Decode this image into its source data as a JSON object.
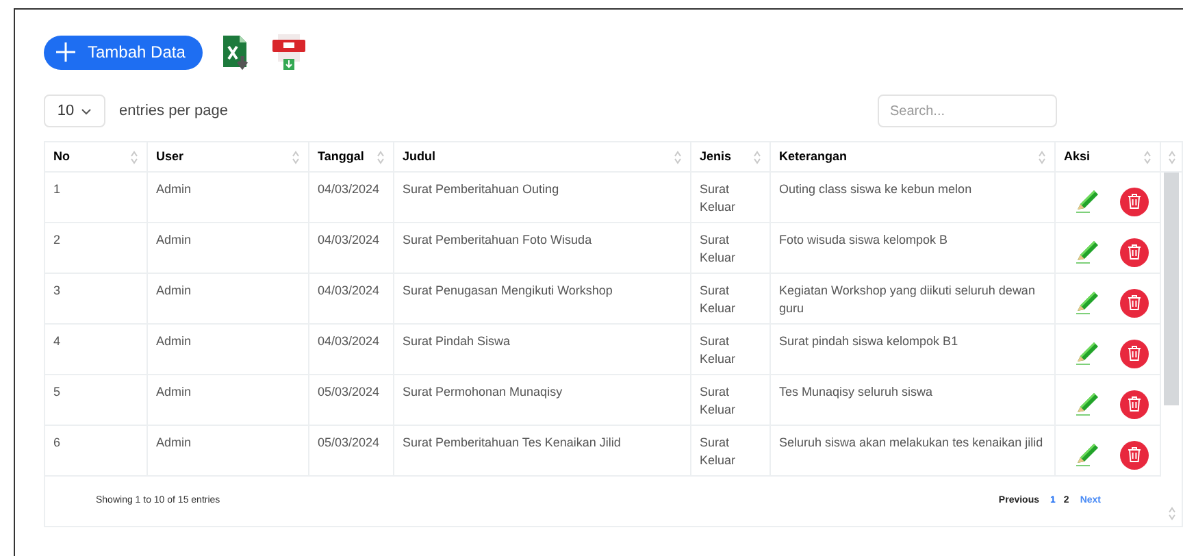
{
  "toolbar": {
    "add_button": "Tambah Data"
  },
  "page_size": {
    "value": "10",
    "label": "entries per page"
  },
  "search": {
    "placeholder": "Search..."
  },
  "table": {
    "columns": [
      "No",
      "User",
      "Tanggal",
      "Judul",
      "Jenis",
      "Keterangan",
      "Aksi"
    ],
    "rows": [
      {
        "no": "1",
        "user": "Admin",
        "tanggal": "04/03/2024",
        "judul": "Surat Pemberitahuan Outing",
        "jenis": "Surat Keluar",
        "keterangan": "Outing class siswa ke kebun melon"
      },
      {
        "no": "2",
        "user": "Admin",
        "tanggal": "04/03/2024",
        "judul": "Surat Pemberitahuan Foto Wisuda",
        "jenis": "Surat Keluar",
        "keterangan": "Foto wisuda siswa kelompok B"
      },
      {
        "no": "3",
        "user": "Admin",
        "tanggal": "04/03/2024",
        "judul": "Surat Penugasan Mengikuti Workshop",
        "jenis": "Surat Keluar",
        "keterangan": "Kegiatan Workshop yang diikuti seluruh dewan guru"
      },
      {
        "no": "4",
        "user": "Admin",
        "tanggal": "04/03/2024",
        "judul": "Surat Pindah Siswa",
        "jenis": "Surat Keluar",
        "keterangan": "Surat pindah siswa kelompok B1"
      },
      {
        "no": "5",
        "user": "Admin",
        "tanggal": "05/03/2024",
        "judul": "Surat Permohonan Munaqisy",
        "jenis": "Surat Keluar",
        "keterangan": "Tes Munaqisy seluruh siswa"
      },
      {
        "no": "6",
        "user": "Admin",
        "tanggal": "05/03/2024",
        "judul": "Surat Pemberitahuan Tes Kenaikan Jilid",
        "jenis": "Surat Keluar",
        "keterangan": "Seluruh siswa akan melakukan tes kenaikan jilid"
      }
    ]
  },
  "footer": {
    "info": "Showing 1 to 10 of 15 entries",
    "pagination": [
      {
        "label": "Previous",
        "kind": "prev",
        "selected": false
      },
      {
        "label": "1",
        "kind": "page",
        "selected": true
      },
      {
        "label": "2",
        "kind": "page",
        "selected": false
      },
      {
        "label": "Next",
        "kind": "next",
        "selected": false
      }
    ]
  }
}
